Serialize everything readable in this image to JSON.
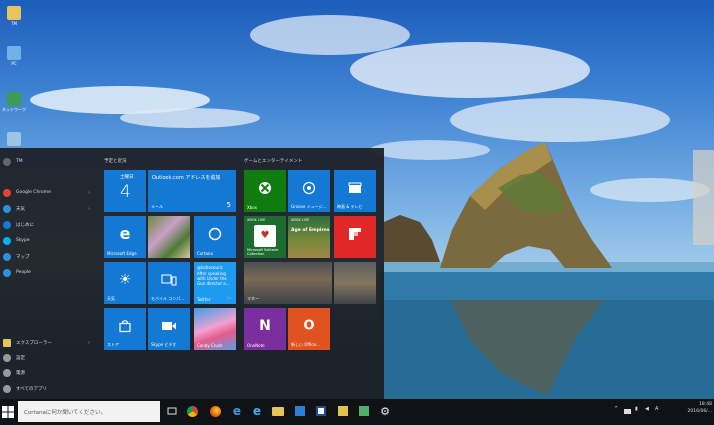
{
  "desktop": {
    "icons": [
      {
        "name": "user-folder-icon",
        "label": "TM"
      },
      {
        "name": "pc-icon",
        "label": "PC"
      },
      {
        "name": "network-icon",
        "label": "ネットワーク"
      },
      {
        "name": "recycle-bin-icon",
        "label": "ごみ箱"
      }
    ]
  },
  "start_menu": {
    "rail": [
      {
        "label": "TM",
        "color": "#666666",
        "chevron": ""
      },
      {
        "label": "Google Chrome",
        "color": "#e3442f",
        "chevron": "›"
      },
      {
        "label": "天気",
        "color": "#2d8fe0",
        "chevron": "›"
      },
      {
        "label": "はじめに",
        "color": "#1479d4",
        "chevron": ""
      },
      {
        "label": "Skype",
        "color": "#00aff0",
        "chevron": ""
      },
      {
        "label": "マップ",
        "color": "#2d8fe0",
        "chevron": ""
      },
      {
        "label": "People",
        "color": "#2d8fe0",
        "chevron": ""
      },
      {
        "label": "エクスプローラー",
        "color": "#e8c45a",
        "chevron": "›"
      },
      {
        "label": "設定",
        "color": "#999999",
        "chevron": ""
      },
      {
        "label": "電源",
        "color": "#999999",
        "chevron": ""
      },
      {
        "label": "すべてのアプリ",
        "color": "#999999",
        "chevron": ""
      }
    ],
    "group_left": "予定と近況",
    "group_right": "ゲームとエンターテイメント",
    "tiles": {
      "calendar_day": "土曜日",
      "calendar_date": "4",
      "outlook_title": "Outlook.com アドレスを追加",
      "outlook_count": "5",
      "mail": "メール",
      "edge": "Microsoft Edge",
      "cortana": "Cortana",
      "weather": "天気",
      "mobile": "モバイル コンパ...",
      "twitter_handle": "@katiecouric",
      "twitter_text": "After speaking with Under the Gun director a...",
      "twitter": "Twitter",
      "store": "ストア",
      "skype_video": "Skype ビデオ",
      "candy_crush": "Candy Crush",
      "xbox": "Xbox",
      "groove": "Groove ミュージ...",
      "movies": "映画 & テレビ",
      "solitaire": "Microsoft Solitaire Collection",
      "xbox_live": "XBOX LIVE",
      "age_of_empires": "Age of Empires",
      "flipboard": "Flipboard",
      "money": "マネー",
      "onenote": "OneNote",
      "office": "新しい Office..."
    }
  },
  "taskbar": {
    "search_placeholder": "Cortanaに何か聞いてください。",
    "clock_time": "18:48",
    "clock_date": "2016/06/..."
  }
}
